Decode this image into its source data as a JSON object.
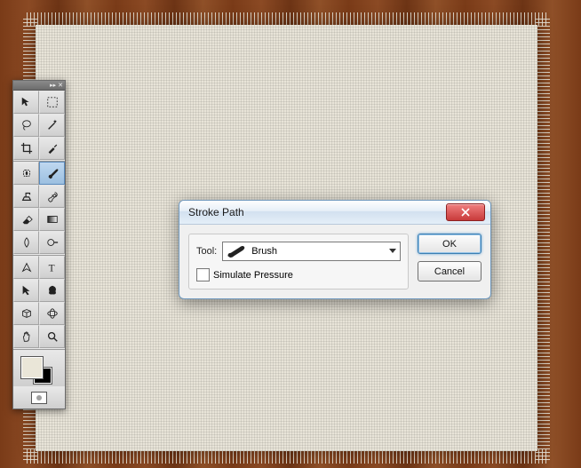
{
  "dialog": {
    "title": "Stroke Path",
    "tool_label": "Tool:",
    "tool_value": "Brush",
    "simulate_label": "Simulate Pressure",
    "simulate_checked": false,
    "ok_label": "OK",
    "cancel_label": "Cancel"
  },
  "swatches": {
    "foreground": "#eae6d8",
    "background": "#000000"
  },
  "tools": [
    [
      "move",
      "marquee-rect"
    ],
    [
      "lasso",
      "magic-wand"
    ],
    [
      "crop",
      "eyedropper"
    ],
    [
      "healing-brush",
      "brush"
    ],
    [
      "clone-stamp",
      "history-brush"
    ],
    [
      "eraser",
      "gradient"
    ],
    [
      "blur",
      "dodge"
    ],
    [
      "pen",
      "type"
    ],
    [
      "path-select",
      "custom-shape"
    ],
    [
      "3d",
      "3d-camera"
    ],
    [
      "hand",
      "zoom"
    ]
  ],
  "selected_tool": "brush"
}
